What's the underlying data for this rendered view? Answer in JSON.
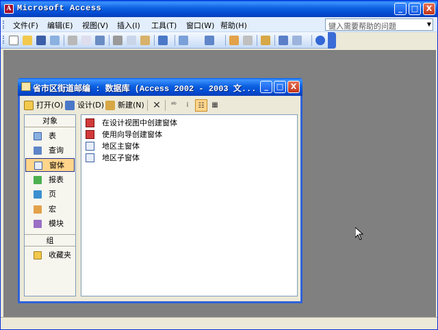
{
  "app": {
    "title": "Microsoft Access",
    "title_icon_letter": "A",
    "caption_buttons": [
      "_",
      "□",
      "X"
    ]
  },
  "menu": {
    "items": [
      "文件(F)",
      "编辑(E)",
      "视图(V)",
      "插入(I)",
      "工具(T)",
      "窗口(W)",
      "帮助(H)"
    ],
    "help_placeholder": "键入需要帮助的问题"
  },
  "toolbar": {
    "icons": [
      "new-icon",
      "open-icon",
      "save-icon",
      "file-search-icon",
      "print-icon",
      "print-preview-icon",
      "spelling-icon",
      "cut-icon",
      "copy-icon",
      "paste-icon",
      "undo-icon",
      "office-links-icon",
      "analyze-icon",
      "code-icon",
      "script-editor-icon",
      "properties-icon",
      "relationships-icon",
      "new-object-icon",
      "help-icon"
    ]
  },
  "db_window": {
    "title": "省市区街道邮编 : 数据库 (Access 2002 - 2003 文...",
    "toolbar": {
      "open": "打开(O)",
      "design": "设计(D)",
      "new": "新建(N)",
      "view_glyphs": [
        "✕",
        "ᵃᵇ",
        "⁞",
        "☷",
        "▦"
      ]
    },
    "objects_header": "对象",
    "objects": [
      "表",
      "查询",
      "窗体",
      "报表",
      "页",
      "宏",
      "模块"
    ],
    "selected_object": "窗体",
    "groups_header": "组",
    "groups": [
      "收藏夹"
    ],
    "list_items": [
      "在设计视图中创建窗体",
      "使用向导创建窗体",
      "地区主窗体",
      "地区子窗体"
    ]
  },
  "colors": {
    "titlebar": "#0d61e0",
    "workspace": "#808080",
    "selected_bg": "#ffd58a"
  }
}
